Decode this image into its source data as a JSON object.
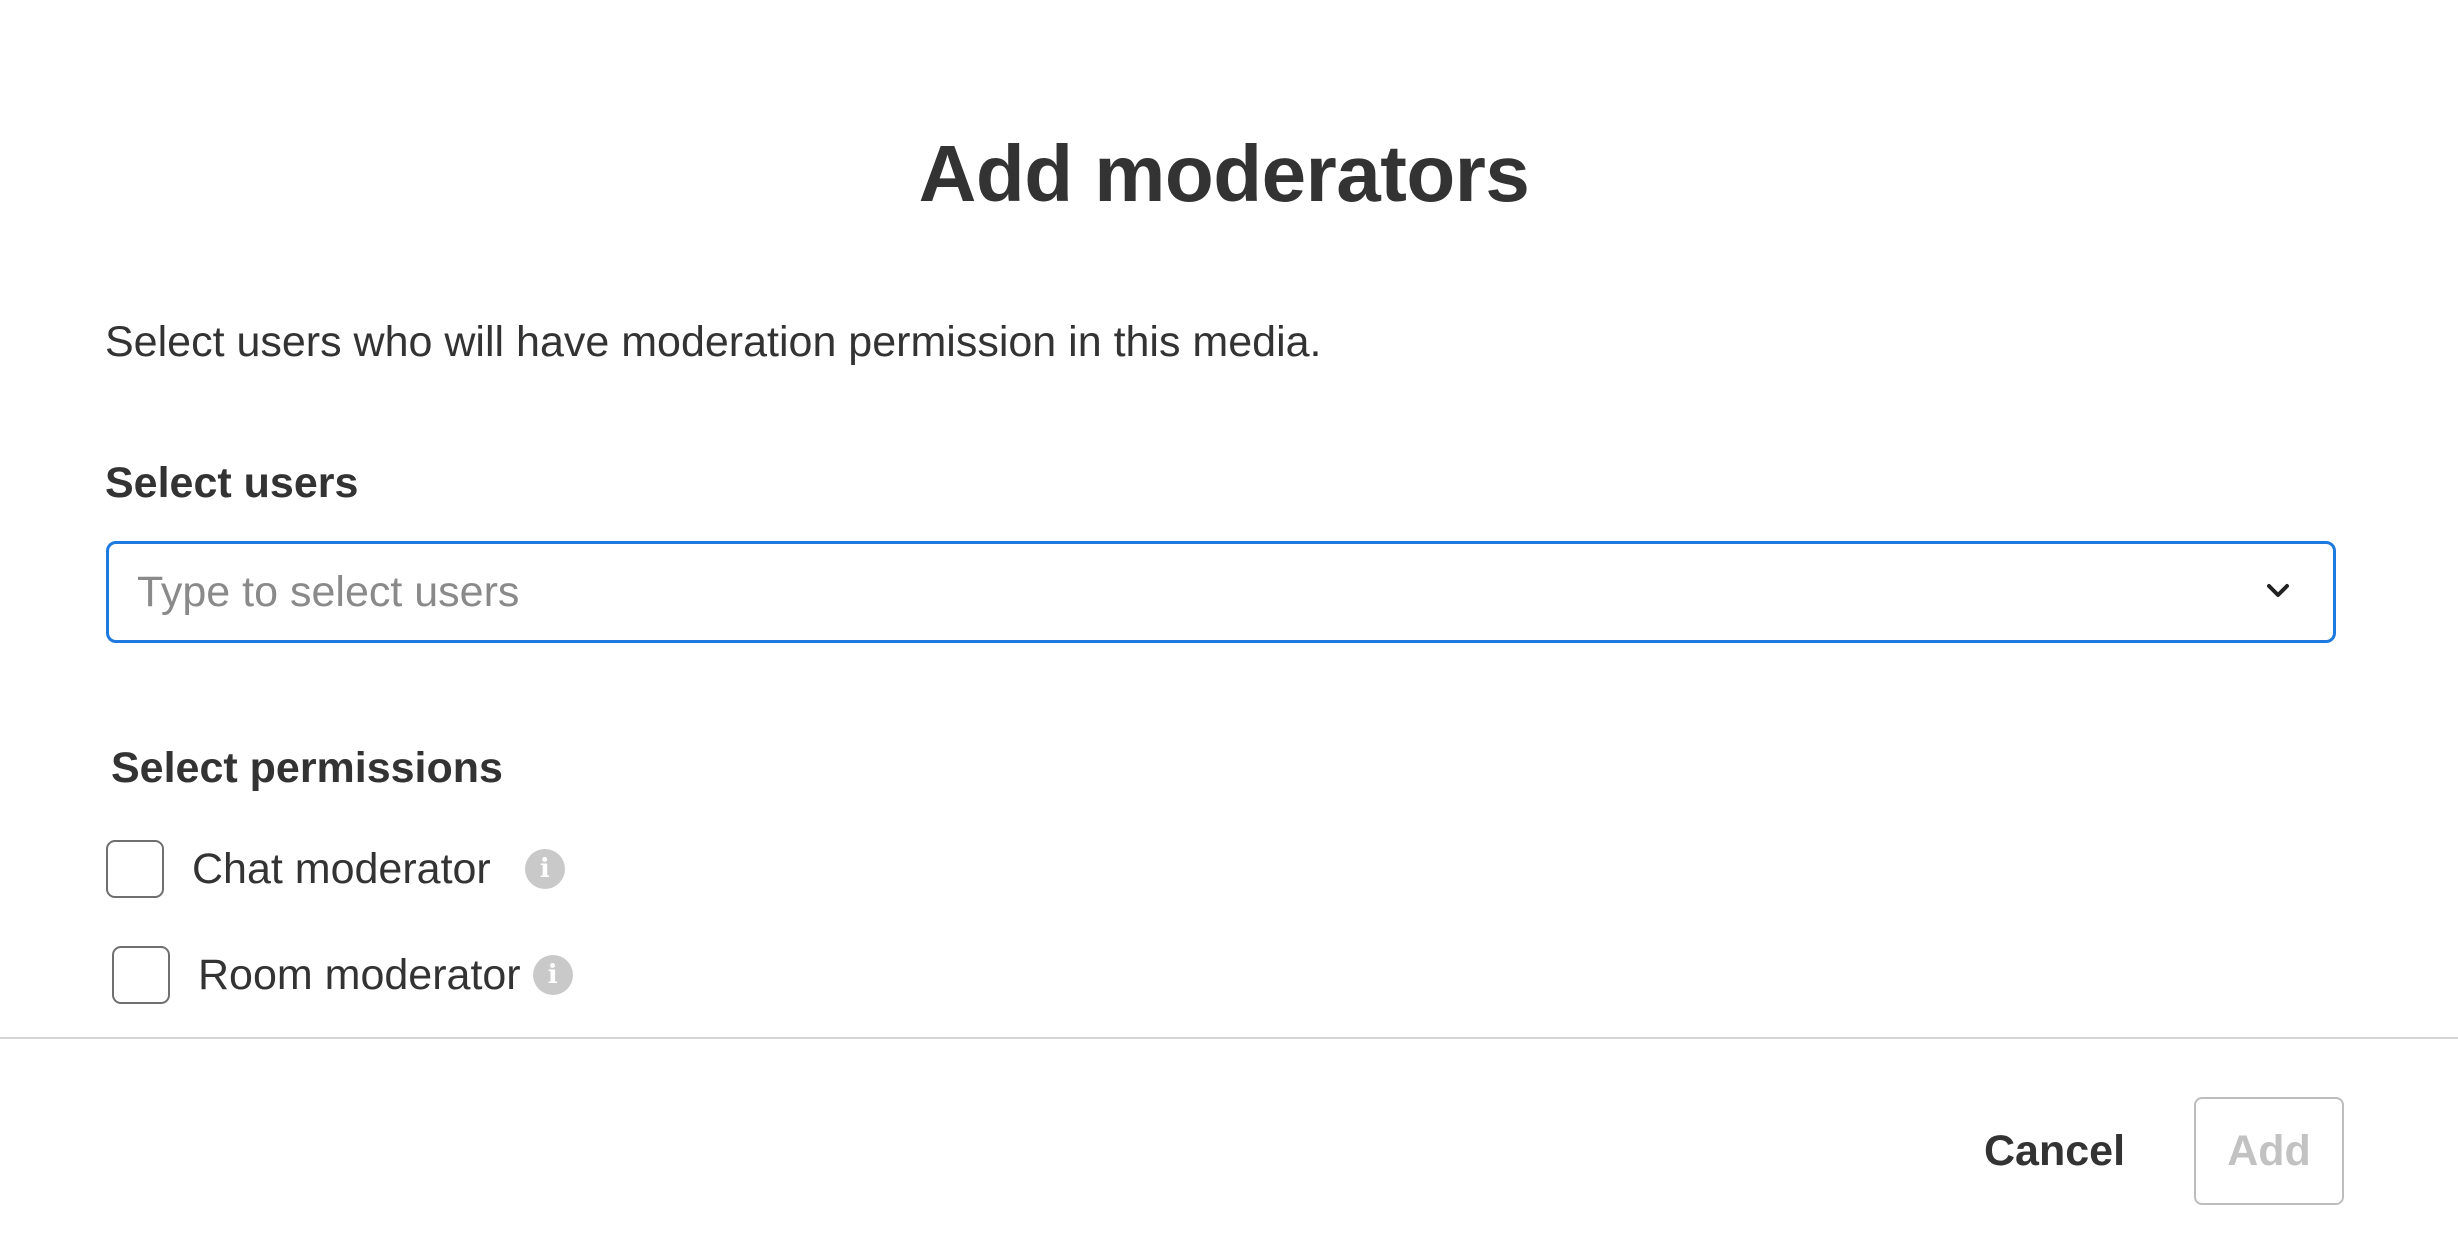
{
  "dialog": {
    "title": "Add moderators",
    "description": "Select users who will have moderation permission in this media."
  },
  "users_field": {
    "label": "Select users",
    "value": "",
    "placeholder": "Type to select users",
    "dropdown_icon": "chevron-down-icon",
    "focus_color": "#1f7ae0"
  },
  "permissions": {
    "label": "Select permissions",
    "items": [
      {
        "label": "Chat moderator",
        "checked": false,
        "info_icon": "info-icon"
      },
      {
        "label": "Room moderator",
        "checked": false,
        "info_icon": "info-icon"
      }
    ]
  },
  "footer": {
    "cancel_label": "Cancel",
    "add_label": "Add",
    "add_disabled": true
  }
}
